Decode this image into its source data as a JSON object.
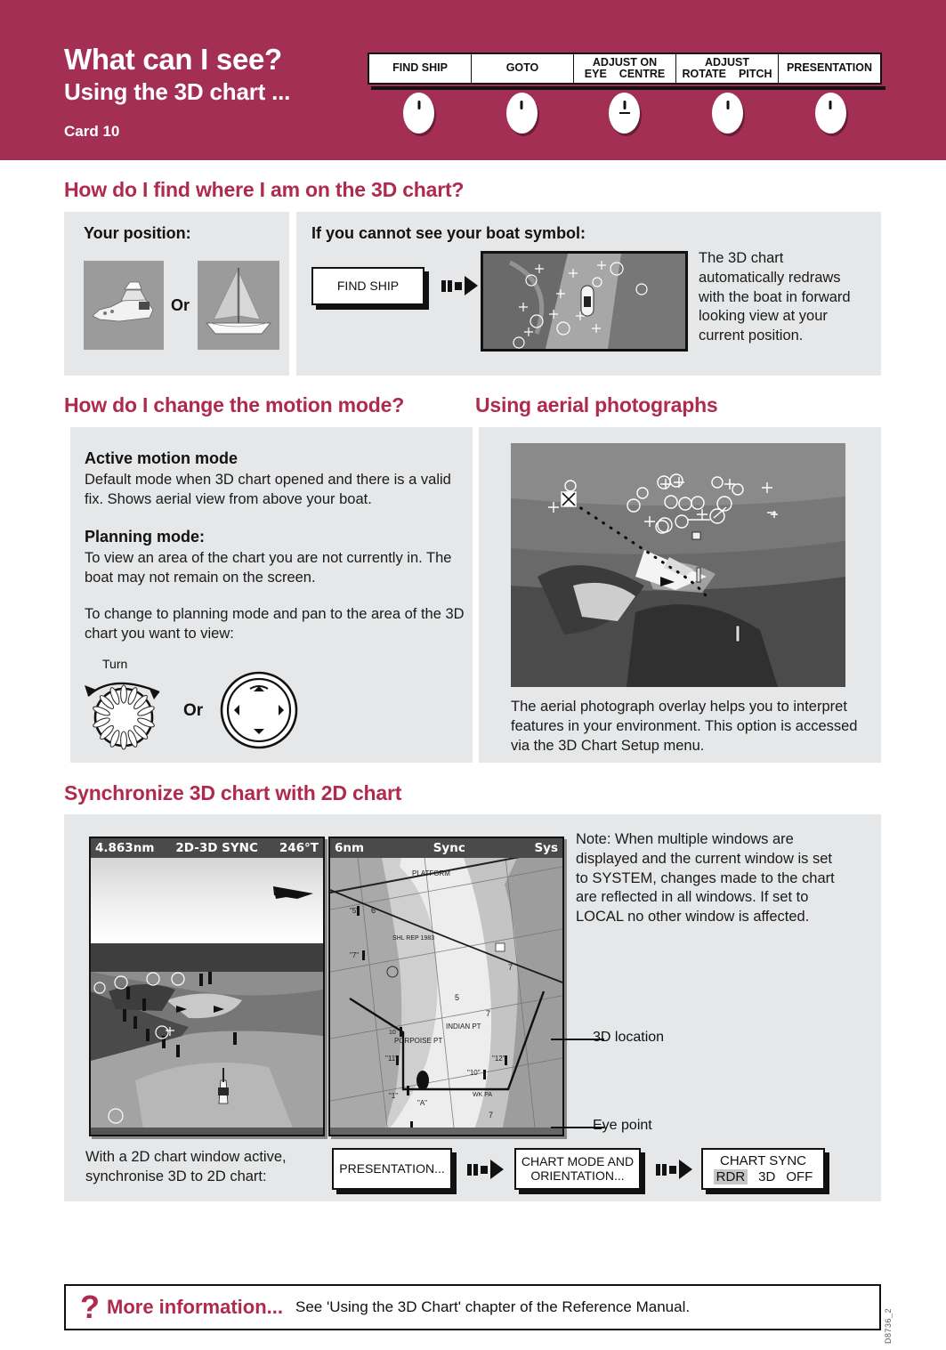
{
  "banner": {
    "title": "What can I see?",
    "subtitle": "Using the 3D chart ...",
    "card": "Card 10"
  },
  "softkeys": [
    {
      "name": "find-ship",
      "line1": "FIND SHIP",
      "line2a": "",
      "line2b": "",
      "button_style": "dot"
    },
    {
      "name": "goto",
      "line1": "GOTO",
      "line2a": "",
      "line2b": "",
      "button_style": "dot"
    },
    {
      "name": "adjust-on",
      "line1": "ADJUST ON",
      "line2a": "EYE",
      "line2b": "CENTRE",
      "button_style": "dot-underline"
    },
    {
      "name": "adjust-rotate-pitch",
      "line1": "ADJUST",
      "line2a": "ROTATE",
      "line2b": "PITCH",
      "button_style": "dot"
    },
    {
      "name": "presentation",
      "line1": "PRESENTATION",
      "line2a": "",
      "line2b": "",
      "button_style": "dot"
    }
  ],
  "section_find": {
    "heading": "How do I find where I am on the 3D chart?",
    "your_position_title": "Your position:",
    "or_label": "Or",
    "boat_power_icon": "power-boat-icon",
    "boat_sail_icon": "sail-boat-icon",
    "cannot_see_title": "If you cannot see your boat symbol:",
    "find_ship_button": "FIND SHIP",
    "result_text": "The 3D chart automatically redraws with the boat in forward looking view at your current position."
  },
  "section_motion": {
    "heading": "How do I change the motion mode?",
    "active_title": "Active motion mode",
    "active_body": "Default mode when 3D chart opened and there is a valid fix.  Shows aerial view from above your boat.",
    "planning_title": "Planning mode:",
    "planning_body": "To view an area of the chart you are not currently in. The boat may not remain on the screen.",
    "change_body": "To change to planning mode and pan to the area of the 3D chart you want to view:",
    "turn_label": "Turn",
    "or_label": "Or",
    "rotary_icon": "rotary-dial-icon",
    "trackpad_icon": "trackpad-cursor-icon"
  },
  "section_aerial": {
    "heading": "Using aerial photographs",
    "caption": "The aerial photograph overlay helps you to interpret features in your environment. This option is accessed via the 3D Chart Setup menu.",
    "photo_name": "aerial-photograph-overlay"
  },
  "section_sync": {
    "heading": "Synchronize 3D chart with 2D chart",
    "screen3d": {
      "range": "4.863nm",
      "mode": "2D-3D SYNC",
      "heading_deg": "246°T"
    },
    "screen2d": {
      "range": "6nm",
      "sync": "Sync",
      "source": "Sys"
    },
    "note": "Note: When multiple windows are displayed and the current window is set to SYSTEM, changes made to the chart are reflected in all windows.  If set to LOCAL no other window is affected.",
    "callout_3d_location": "3D location",
    "callout_eye_point": "Eye point",
    "instruction": "With a 2D chart window active, synchronise 3D to 2D chart:",
    "steps": [
      {
        "name": "presentation-step",
        "label": "PRESENTATION..."
      },
      {
        "name": "chart-mode-step",
        "line1": "CHART MODE AND",
        "line2": "ORIENTATION..."
      },
      {
        "name": "chart-sync-step",
        "title": "CHART SYNC",
        "options": [
          "RDR",
          "3D",
          "OFF"
        ],
        "selected": "RDR"
      }
    ]
  },
  "footer": {
    "q": "?",
    "more_info": "More information...",
    "text": "See 'Using the 3D Chart' chapter of the Reference Manual.",
    "doc_id": "D8736_2"
  },
  "colors": {
    "brand": "#a32f54",
    "heading": "#b02a4e",
    "panel": "#e6e7e8",
    "ink": "#111111"
  }
}
